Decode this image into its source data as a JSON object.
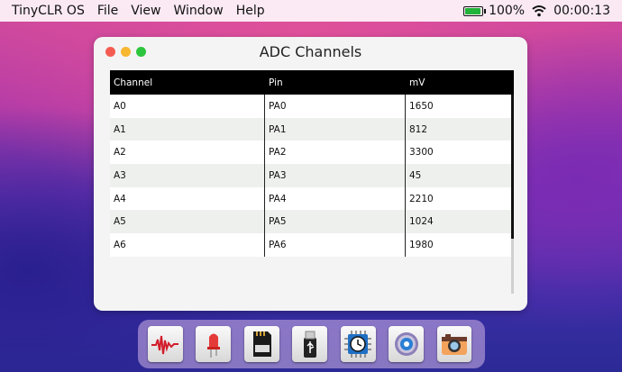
{
  "menubar": {
    "app_name": "TinyCLR OS",
    "menus": [
      "File",
      "View",
      "Window",
      "Help"
    ],
    "battery_percent": "100%",
    "battery_level": 1.0,
    "clock": "00:00:13"
  },
  "window": {
    "title": "ADC Channels",
    "columns": [
      "Channel",
      "Pin",
      "mV"
    ],
    "rows": [
      [
        "A0",
        "PA0",
        "1650"
      ],
      [
        "A1",
        "PA1",
        "812"
      ],
      [
        "A2",
        "PA2",
        "3300"
      ],
      [
        "A3",
        "PA3",
        "45"
      ],
      [
        "A4",
        "PA4",
        "2210"
      ],
      [
        "A5",
        "PA5",
        "1024"
      ],
      [
        "A6",
        "PA6",
        "1980"
      ]
    ]
  },
  "dock": {
    "icons": [
      "oscilloscope-icon",
      "led-icon",
      "sd-card-icon",
      "usb-drive-icon",
      "clock-chip-icon",
      "settings-gear-icon",
      "camera-icon"
    ]
  },
  "colors": {
    "accent_green": "#21b33a",
    "close": "#f45c52",
    "minimize": "#f7b731",
    "maximize": "#2dc53e"
  }
}
